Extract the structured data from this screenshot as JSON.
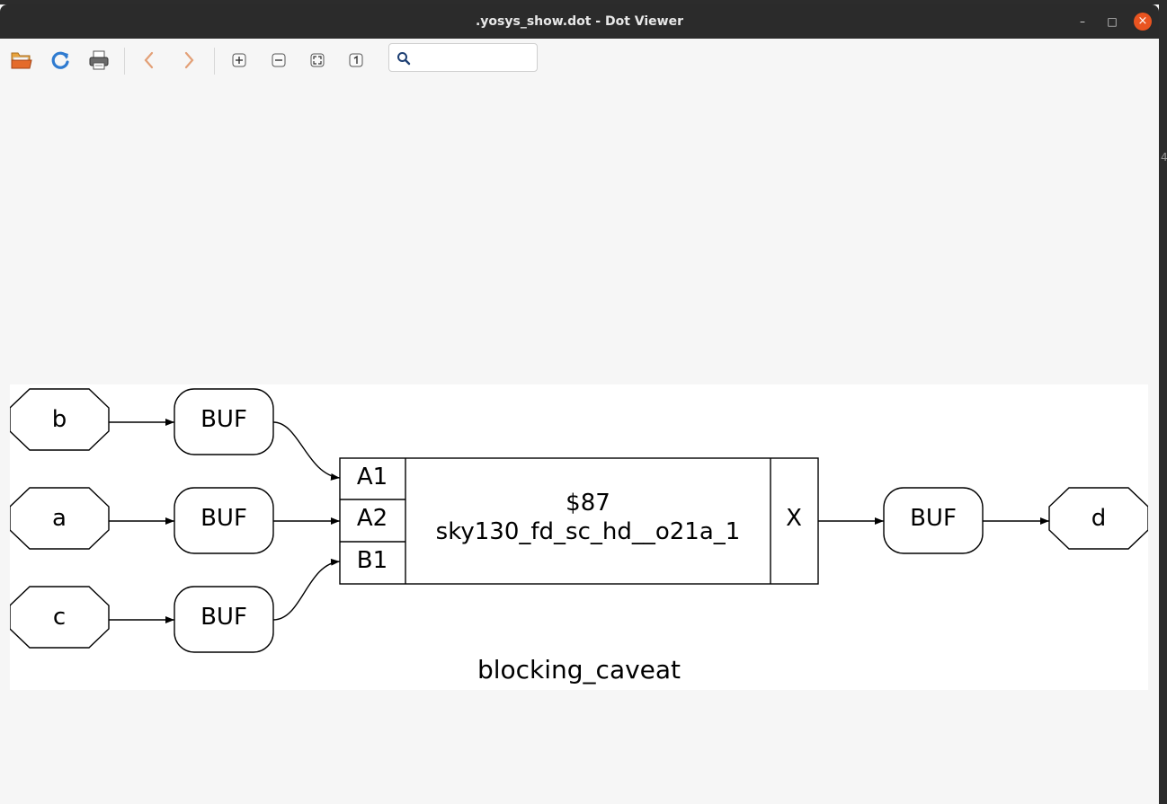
{
  "window": {
    "title": ".yosys_show.dot - Dot Viewer"
  },
  "titlebar": {
    "minimize": "–",
    "maximize": "□",
    "close": "×"
  },
  "toolbar": {
    "icons": [
      "open-icon",
      "reload-icon",
      "print-icon",
      "back-icon",
      "forward-icon",
      "zoom-in-icon",
      "zoom-out-icon",
      "zoom-fit-icon",
      "zoom-100-icon"
    ],
    "search_value": ""
  },
  "graph": {
    "label": "blocking_caveat",
    "inputs": [
      "b",
      "a",
      "c"
    ],
    "output": "d",
    "buffer_label": "BUF",
    "cell": {
      "id": "$87",
      "type": "sky130_fd_sc_hd__o21a_1",
      "input_ports": [
        "A1",
        "A2",
        "B1"
      ],
      "output_port": "X"
    }
  },
  "side_text": "4"
}
